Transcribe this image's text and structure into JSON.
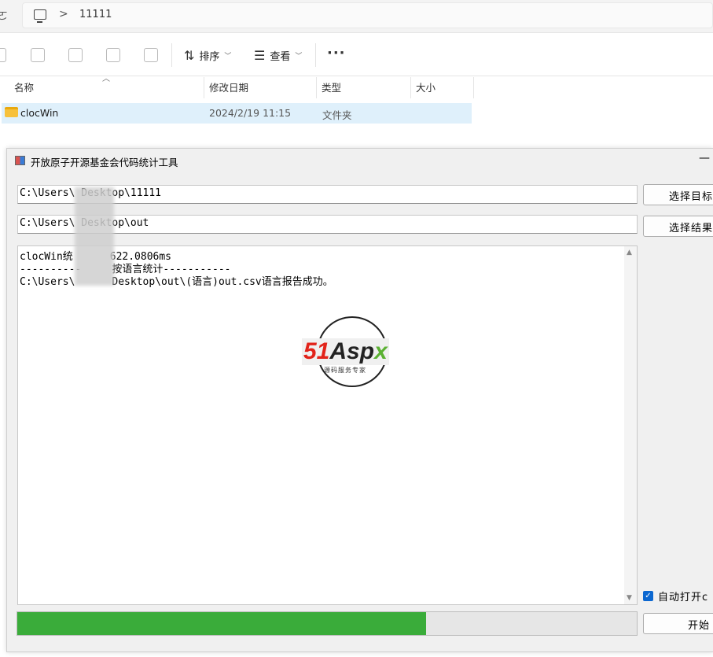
{
  "explorer": {
    "address": {
      "edge_glyph": "ㄛ",
      "separator": ">",
      "folder": "11111"
    },
    "toolbar": {
      "sort_label": "排序",
      "view_label": "查看",
      "more_label": "···"
    },
    "columns": {
      "name": "名称",
      "modified": "修改日期",
      "type": "类型",
      "size": "大小"
    },
    "files": [
      {
        "name": "clocWin",
        "modified": "2024/2/19 11:15",
        "type": "文件夹",
        "size": ""
      }
    ]
  },
  "app": {
    "title": "开放原子开源基金会代码统计工具",
    "minimize_label": "—",
    "source_path": "C:\\Users\\      Desktop\\11111",
    "output_path": "C:\\Users\\      Desktop\\out",
    "select_source_label": "选择目标",
    "select_output_label": "选择结果",
    "log_lines": [
      "clocWin统      622.0806ms",
      "----------     按语言统计-----------",
      "C:\\Users\\      Desktop\\out\\(语言)out.csv语言报告成功。"
    ],
    "watermark": {
      "brand_a": "51",
      "brand_b": "Asp",
      "brand_c": "x",
      "tagline": "源码服务专家"
    },
    "auto_open_label": "自动打开c",
    "auto_open_checked": true,
    "start_label": "开始",
    "progress_percent": 66,
    "progress_color": "#3aac3a"
  }
}
